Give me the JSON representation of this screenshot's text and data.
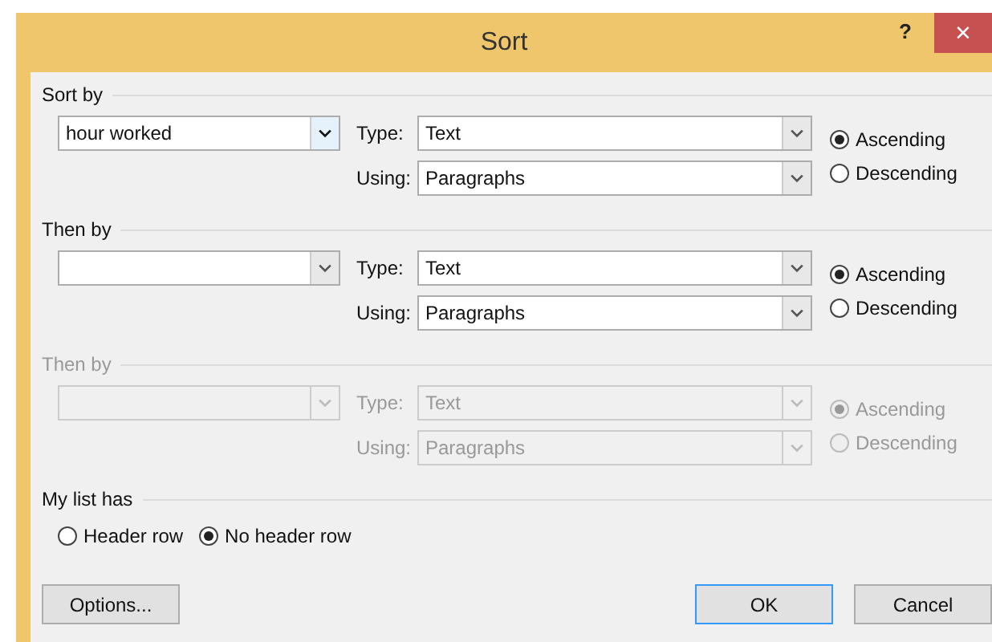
{
  "window": {
    "title": "Sort",
    "help": "?",
    "close": "×"
  },
  "sections": [
    {
      "title": "Sort by",
      "disabled": false,
      "field": {
        "value": "hour worked"
      },
      "type": {
        "label": "Type:",
        "value": "Text"
      },
      "using": {
        "label": "Using:",
        "value": "Paragraphs"
      },
      "order": [
        {
          "label": "Ascending",
          "selected": true
        },
        {
          "label": "Descending",
          "selected": false
        }
      ]
    },
    {
      "title": "Then by",
      "disabled": false,
      "type": {
        "label": "Type:",
        "value": "Text"
      },
      "using": {
        "label": "Using:",
        "value": "Paragraphs"
      },
      "order": [
        {
          "label": "Ascending",
          "selected": true
        },
        {
          "label": "Descending",
          "selected": false
        }
      ]
    },
    {
      "title": "Then by",
      "disabled": true,
      "type": {
        "label": "Type:",
        "value": "Text"
      },
      "using": {
        "label": "Using:",
        "value": "Paragraphs"
      },
      "order": [
        {
          "label": "Ascending",
          "selected": true
        },
        {
          "label": "Descending",
          "selected": false
        }
      ]
    }
  ],
  "list_has": {
    "title": "My list has",
    "options": [
      {
        "label": "Header row",
        "selected": false
      },
      {
        "label": "No header row",
        "selected": true
      }
    ]
  },
  "buttons": [
    {
      "label": "Options...",
      "kind": "secondary"
    },
    {
      "label": "OK",
      "kind": "default"
    },
    {
      "label": "Cancel",
      "kind": "secondary"
    }
  ]
}
